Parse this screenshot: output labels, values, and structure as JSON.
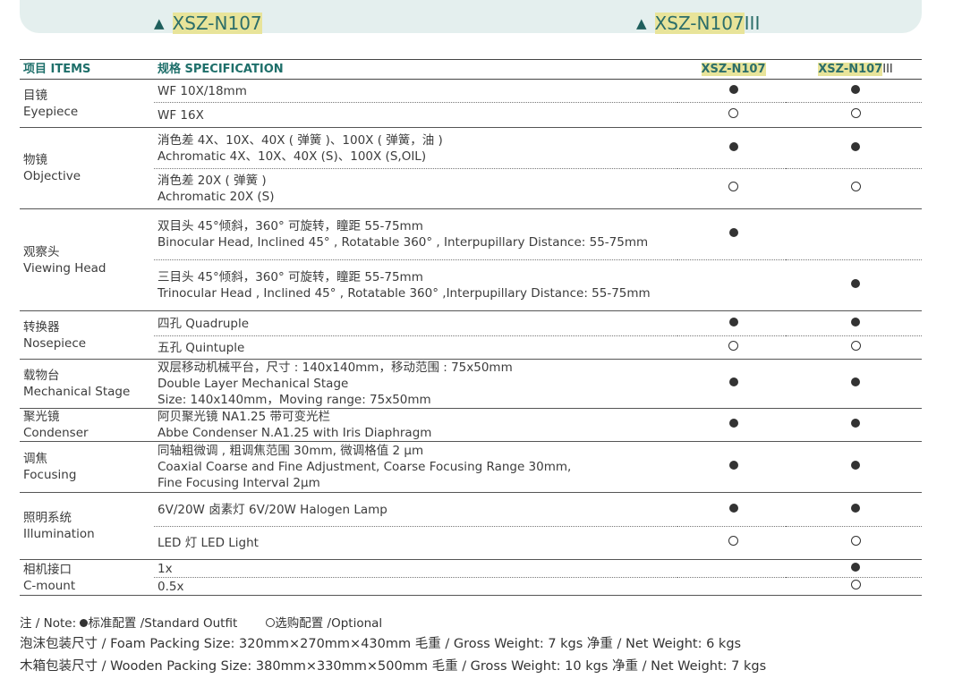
{
  "banner": {
    "left_model": "XSZ-N107",
    "right_model": "XSZ-N107",
    "right_suffix": "III"
  },
  "table": {
    "header": {
      "items": "项目 ITEMS",
      "spec": "规格 SPECIFICATION",
      "model1": "XSZ-N107",
      "model2": "XSZ-N107",
      "model2_suffix": "III"
    },
    "groups": [
      {
        "item_cn": "目镜",
        "item_en": "Eyepiece",
        "rows": [
          {
            "lines": [
              "WF 10X/18mm"
            ],
            "m1": "filled",
            "m2": "filled"
          },
          {
            "lines": [
              "WF 16X"
            ],
            "m1": "empty",
            "m2": "empty"
          }
        ]
      },
      {
        "item_cn": "物镜",
        "item_en": "Objective",
        "rows": [
          {
            "lines": [
              "消色差 4X、10X、40X ( 弹簧 )、100X ( 弹簧，油 )",
              "Achromatic  4X、10X、40X (S)、100X (S,OIL)"
            ],
            "m1": "filled",
            "m2": "filled"
          },
          {
            "lines": [
              "消色差 20X ( 弹簧 )",
              "Achromatic 20X (S)"
            ],
            "m1": "empty",
            "m2": "empty"
          }
        ]
      },
      {
        "item_cn": "观察头",
        "item_en": "Viewing Head",
        "rows": [
          {
            "lines": [
              "双目头 45°倾斜，360° 可旋转，瞳距 55-75mm",
              "Binocular Head, Inclined 45° , Rotatable 360° , Interpupillary Distance: 55-75mm"
            ],
            "m1": "filled",
            "m2": ""
          },
          {
            "lines": [
              "三目头 45°倾斜，360° 可旋转，瞳距 55-75mm",
              "Trinocular Head ,  Inclined 45° , Rotatable 360° ,Interpupillary Distance: 55-75mm"
            ],
            "m1": "",
            "m2": "filled"
          }
        ]
      },
      {
        "item_cn": "转换器",
        "item_en": "Nosepiece",
        "rows": [
          {
            "lines": [
              "四孔  Quadruple"
            ],
            "m1": "filled",
            "m2": "filled"
          },
          {
            "lines": [
              "五孔  Quintuple"
            ],
            "m1": "empty",
            "m2": "empty"
          }
        ]
      },
      {
        "item_cn": "载物台",
        "item_en": "Mechanical Stage",
        "rows": [
          {
            "lines": [
              "双层移动机械平台，尺寸 : 140x140mm，移动范围 : 75x50mm",
              "Double Layer Mechanical Stage",
              "Size: 140x140mm，Moving range: 75x50mm"
            ],
            "m1": "filled",
            "m2": "filled"
          }
        ]
      },
      {
        "item_cn": "聚光镜",
        "item_en": "Condenser",
        "rows": [
          {
            "lines": [
              "阿贝聚光镜 NA1.25 带可变光栏",
              "Abbe Condenser N.A1.25 with Iris Diaphragm"
            ],
            "m1": "filled",
            "m2": "filled"
          }
        ]
      },
      {
        "item_cn": "调焦",
        "item_en": "Focusing",
        "rows": [
          {
            "lines": [
              "同轴粗微调 , 粗调焦范围 30mm, 微调格值 2 μm",
              "Coaxial Coarse and Fine Adjustment, Coarse Focusing Range 30mm,",
              "Fine Focusing Interval 2μm"
            ],
            "m1": "filled",
            "m2": "filled"
          }
        ]
      },
      {
        "item_cn": "照明系统",
        "item_en": "Illumination",
        "rows": [
          {
            "lines": [
              "6V/20W 卤素灯  6V/20W Halogen Lamp"
            ],
            "m1": "filled",
            "m2": "filled"
          },
          {
            "lines": [
              "LED 灯 LED Light"
            ],
            "m1": "empty",
            "m2": "empty"
          }
        ]
      },
      {
        "item_cn": "相机接口",
        "item_en": "C-mount",
        "rows": [
          {
            "lines": [
              "1x"
            ],
            "m1": "",
            "m2": "filled"
          },
          {
            "lines": [
              "0.5x"
            ],
            "m1": "",
            "m2": "empty"
          }
        ]
      }
    ]
  },
  "notes": {
    "note_prefix": "注 / Note: ",
    "standard_label": "标准配置 /Standard Outfit",
    "optional_label": "选购配置 /Optional",
    "foam": "泡沫包装尺寸 / Foam Packing Size: 320mm×270mm×430mm  毛重 / Gross Weight: 7 kgs   净重 / Net Weight: 6 kgs",
    "wooden": "木箱包装尺寸 / Wooden Packing Size: 380mm×330mm×500mm  毛重 / Gross Weight: 10 kgs   净重 / Net Weight: 7 kgs"
  }
}
